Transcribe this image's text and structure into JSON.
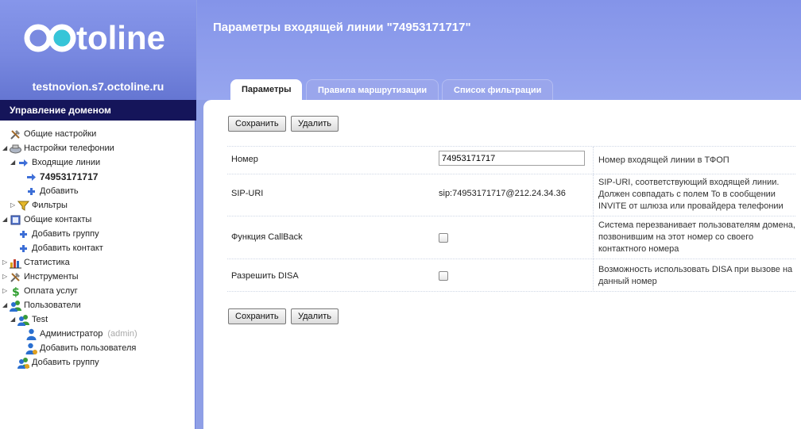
{
  "brand": {
    "logo_text": "octoline",
    "domain_host": "testnovion.s7.octoline.ru"
  },
  "sidebar": {
    "section_title": "Управление доменом",
    "items": [
      {
        "label": "Общие настройки",
        "icon": "tools-icon"
      },
      {
        "label": "Настройки телефонии",
        "icon": "phone-icon"
      },
      {
        "label": "Входящие линии",
        "icon": "arrow-right-icon"
      },
      {
        "label": "74953171717",
        "icon": "arrow-right-icon"
      },
      {
        "label": "Добавить",
        "icon": "plus-icon"
      },
      {
        "label": "Фильтры",
        "icon": "filter-icon"
      },
      {
        "label": "Общие контакты",
        "icon": "book-icon"
      },
      {
        "label": "Добавить группу",
        "icon": "plus-icon"
      },
      {
        "label": "Добавить контакт",
        "icon": "plus-icon"
      },
      {
        "label": "Статистика",
        "icon": "chart-icon"
      },
      {
        "label": "Инструменты",
        "icon": "tools-icon"
      },
      {
        "label": "Оплата услуг",
        "icon": "dollar-icon"
      },
      {
        "label": "Пользователи",
        "icon": "users-icon"
      },
      {
        "label": "Test",
        "icon": "users-icon"
      },
      {
        "label": "Администратор",
        "sublabel": "(admin)",
        "icon": "user-icon"
      },
      {
        "label": "Добавить пользователя",
        "icon": "add-user-icon"
      },
      {
        "label": "Добавить группу",
        "icon": "add-group-icon"
      }
    ]
  },
  "header": {
    "title": "Параметры входящей линии \"74953171717\"",
    "tabs": [
      {
        "label": "Параметры",
        "active": true
      },
      {
        "label": "Правила маршрутизации",
        "active": false
      },
      {
        "label": "Список фильтрации",
        "active": false
      }
    ]
  },
  "toolbar": {
    "save_label": "Сохранить",
    "delete_label": "Удалить"
  },
  "form": {
    "rows": [
      {
        "label": "Номер",
        "value": "74953171717",
        "description": "Номер входящей линии в ТФОП"
      },
      {
        "label": "SIP-URI",
        "value": "sip:74953171717@212.24.34.36",
        "description": "SIP-URI, соответствующий входящей линии. Должен совпадать с полем To в сообщении INVITE от шлюза или провайдера телефонии"
      },
      {
        "label": "Функция CallBack",
        "checked": false,
        "description": "Система перезванивает пользователям домена, позвонившим на этот номер со своего контактного номера"
      },
      {
        "label": "Разрешить DISA",
        "checked": false,
        "description": "Возможность использовать DISA при вызове на данный номер"
      }
    ]
  },
  "colors": {
    "header_blue": "#8696ea",
    "section_bar": "#15155a",
    "logo_teal": "#36c5d8"
  }
}
